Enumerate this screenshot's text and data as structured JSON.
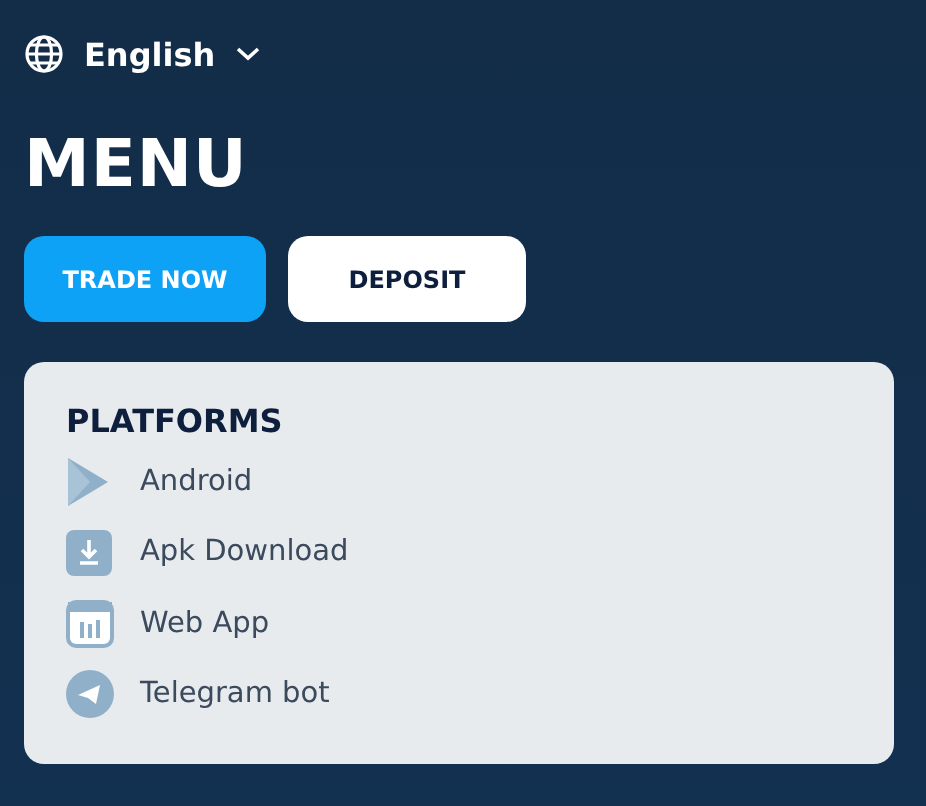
{
  "language": {
    "label": "English"
  },
  "title": "MENU",
  "buttons": [
    {
      "label": "TRADE NOW",
      "kind": "primary"
    },
    {
      "label": "DEPOSIT",
      "kind": "secondary"
    }
  ],
  "platforms": {
    "heading": "PLATFORMS",
    "items": [
      {
        "label": "Android",
        "kind": "play"
      },
      {
        "label": "Apk Download",
        "kind": "download"
      },
      {
        "label": "Web App",
        "kind": "webapp"
      },
      {
        "label": "Telegram bot",
        "kind": "telegram"
      }
    ]
  }
}
